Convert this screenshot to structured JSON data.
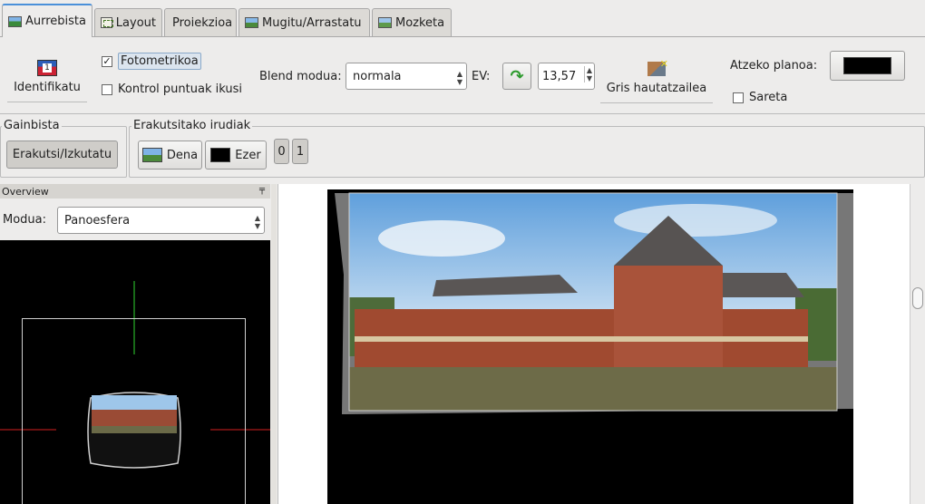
{
  "tabs": [
    {
      "label": "Aurrebista",
      "icon": "gl-preview-icon",
      "active": true
    },
    {
      "label": "Layout",
      "icon": "layout-icon",
      "active": false
    },
    {
      "label": "Proiekzioa",
      "icon": "",
      "active": false
    },
    {
      "label": "Mugitu/Arrastatu",
      "icon": "move-drag-icon",
      "active": false
    },
    {
      "label": "Mozketa",
      "icon": "crop-icon",
      "active": false
    }
  ],
  "toolbar": {
    "identify_label": "Identifikatu",
    "photometric_label": "Fotometrikoa",
    "photometric_checked": true,
    "control_points_label": "Kontrol puntuak ikusi",
    "control_points_checked": false,
    "blend_mode_label": "Blend modua:",
    "blend_mode_value": "normala",
    "ev_label": "EV:",
    "ev_value": "13,57",
    "gray_picker_label": "Gris hautatzailea",
    "background_label": "Atzeko planoa:",
    "background_color": "#000000",
    "grid_label": "Sareta",
    "grid_checked": false
  },
  "overview_group": {
    "title": "Gainbista",
    "toggle_label": "Erakutsi/Izkutatu"
  },
  "images_group": {
    "title": "Erakutsitako irudiak",
    "all_label": "Dena",
    "none_label": "Ezer",
    "image_buttons": [
      "0",
      "1"
    ]
  },
  "overview": {
    "header": "Overview",
    "mode_label": "Modua:",
    "mode_value": "Panoesfera"
  },
  "colors": {
    "accent": "#4a90d9",
    "axis_green": "#2fd62f",
    "axis_red": "#d42020"
  }
}
